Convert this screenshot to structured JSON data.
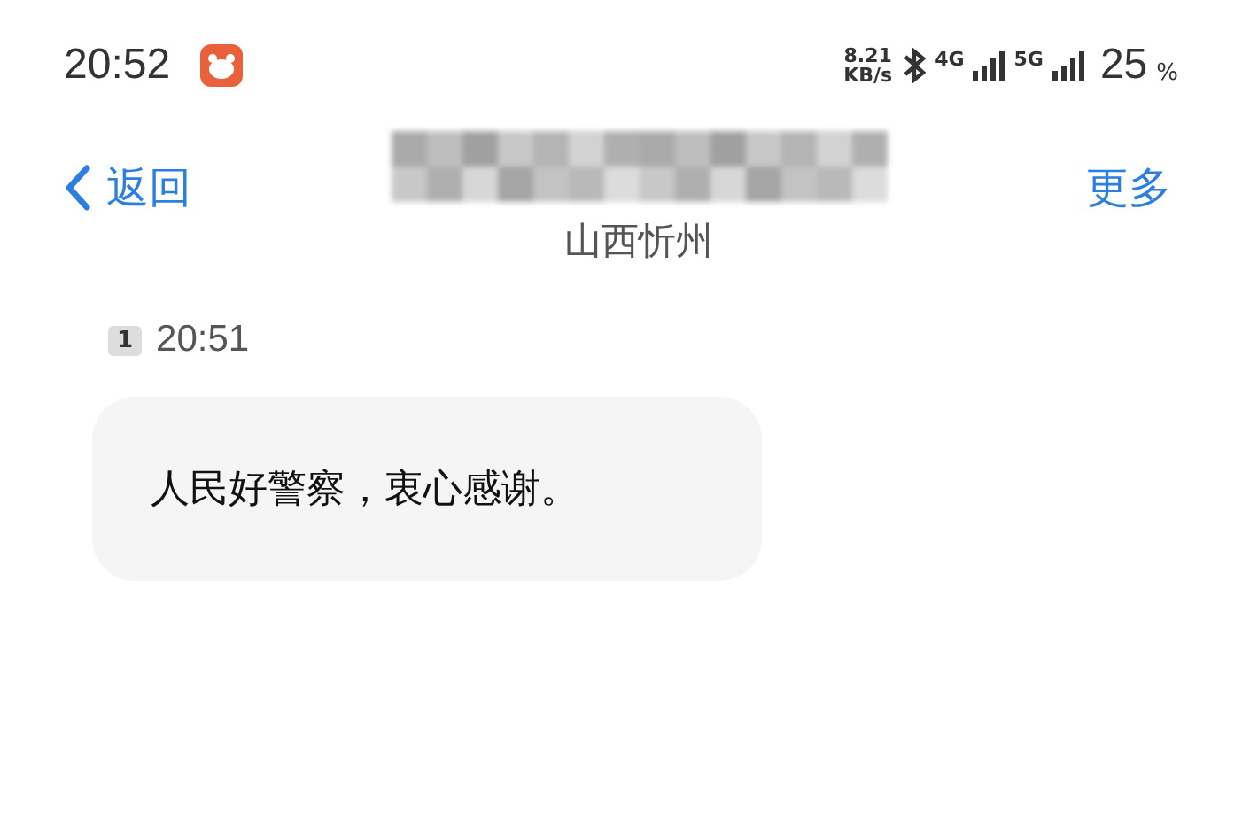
{
  "status_bar": {
    "time": "20:52",
    "net_speed": "8.21",
    "net_unit": "KB/s",
    "network_1": "4G",
    "network_2": "5G",
    "battery": "25",
    "battery_unit": "%"
  },
  "header": {
    "back": "返回",
    "subtitle": "山西忻州",
    "more": "更多"
  },
  "messages": [
    {
      "sim": "1",
      "time": "20:51",
      "text": "人民好警察，衷心感谢。"
    }
  ]
}
